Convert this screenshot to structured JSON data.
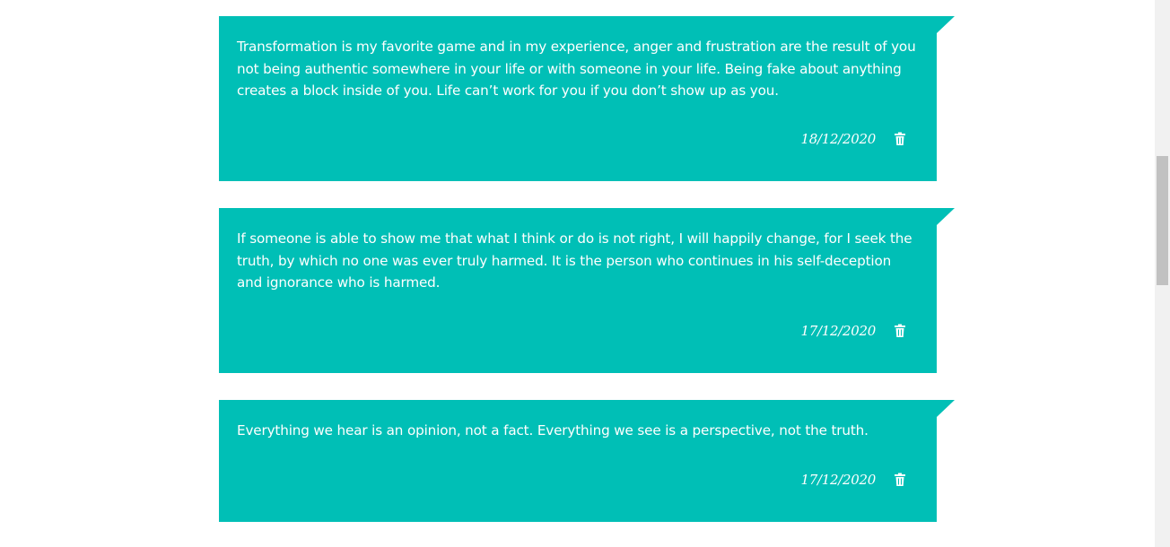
{
  "notes": [
    {
      "text": "Transformation is my favorite game and in my experience, anger and frustration are the result of you not being authentic somewhere in your life or with someone in your life. Being fake about anything creates a block inside of you. Life can’t work for you if you don’t show up as you.",
      "date": "18/12/2020",
      "delete_icon": "trash-icon"
    },
    {
      "text": "If someone is able to show me that what I think or do is not right, I will happily change, for I seek the truth, by which no one was ever truly harmed. It is the person who continues in his self-deception and ignorance who is harmed.",
      "date": "17/12/2020",
      "delete_icon": "trash-icon"
    },
    {
      "text": "Everything we hear is an opinion, not a fact. Everything we see is a perspective, not the truth.",
      "date": "17/12/2020",
      "delete_icon": "trash-icon"
    }
  ],
  "colors": {
    "note_background": "#00bfb6",
    "note_text": "#ffffff",
    "page_background": "#ffffff",
    "scrollbar_track": "#f1f1f1",
    "scrollbar_thumb": "#c1c1c1"
  }
}
